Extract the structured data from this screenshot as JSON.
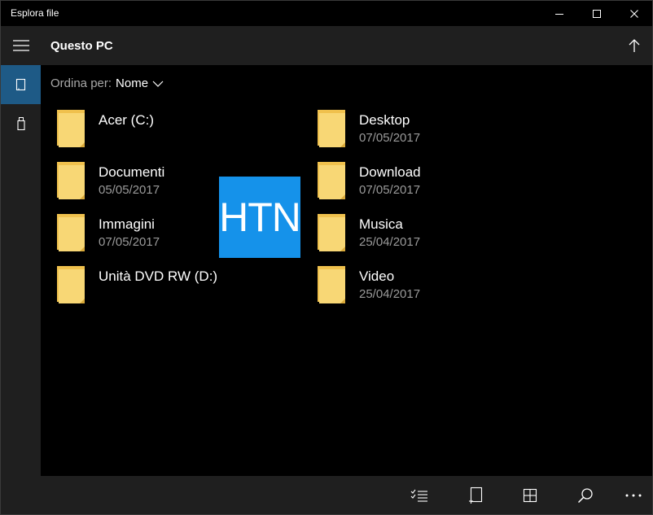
{
  "window": {
    "title": "Esplora file"
  },
  "header": {
    "location": "Questo PC"
  },
  "sort": {
    "label": "Ordina per:",
    "value": "Nome"
  },
  "items": [
    {
      "name": "Acer (C:)",
      "date": ""
    },
    {
      "name": "Desktop",
      "date": "07/05/2017"
    },
    {
      "name": "Documenti",
      "date": "05/05/2017"
    },
    {
      "name": "Download",
      "date": "07/05/2017"
    },
    {
      "name": "Immagini",
      "date": "07/05/2017"
    },
    {
      "name": "Musica",
      "date": "25/04/2017"
    },
    {
      "name": "Unità DVD RW (D:)",
      "date": ""
    },
    {
      "name": "Video",
      "date": "25/04/2017"
    }
  ],
  "watermark": {
    "text": "HTN"
  },
  "colors": {
    "accent": "#1e5a86",
    "folder": "#f8d775",
    "watermark": "#1592ea"
  },
  "icons": {
    "rail": [
      "hamburger-icon",
      "device-icon",
      "usb-drive-icon"
    ],
    "toolbar": [
      "select-icon",
      "new-tablet-icon",
      "grid-view-icon",
      "search-icon",
      "more-icon"
    ]
  }
}
